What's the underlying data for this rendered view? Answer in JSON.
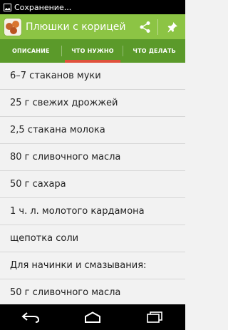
{
  "status_bar": {
    "notification_icon": "image-icon",
    "text": "Сохранение..."
  },
  "action_bar": {
    "title": "Плюшки с корицей",
    "share_icon": "share-icon",
    "pin_icon": "pin-icon"
  },
  "tabs": [
    {
      "label": "ОПИСАНИЕ",
      "active": false
    },
    {
      "label": "ЧТО НУЖНО",
      "active": true
    },
    {
      "label": "ЧТО ДЕЛАТЬ",
      "active": false
    }
  ],
  "ingredients": [
    "6–7 стаканов муки",
    "25 г свежих дрожжей",
    "2,5 стакана молока",
    "80 г сливочного масла",
    "50 г сахара",
    "1 ч. л. молотого кардамона",
    "щепотка соли",
    "Для начинки и смазывания:",
    "50 г сливочного масла"
  ],
  "nav_bar": {
    "back_icon": "back-icon",
    "home_icon": "home-icon",
    "recents_icon": "recents-icon"
  },
  "colors": {
    "action_bar": "#8cc444",
    "tab_bar": "#5b9a2a",
    "tab_indicator": "#e0513c",
    "list_bg": "#f2f2f2"
  }
}
